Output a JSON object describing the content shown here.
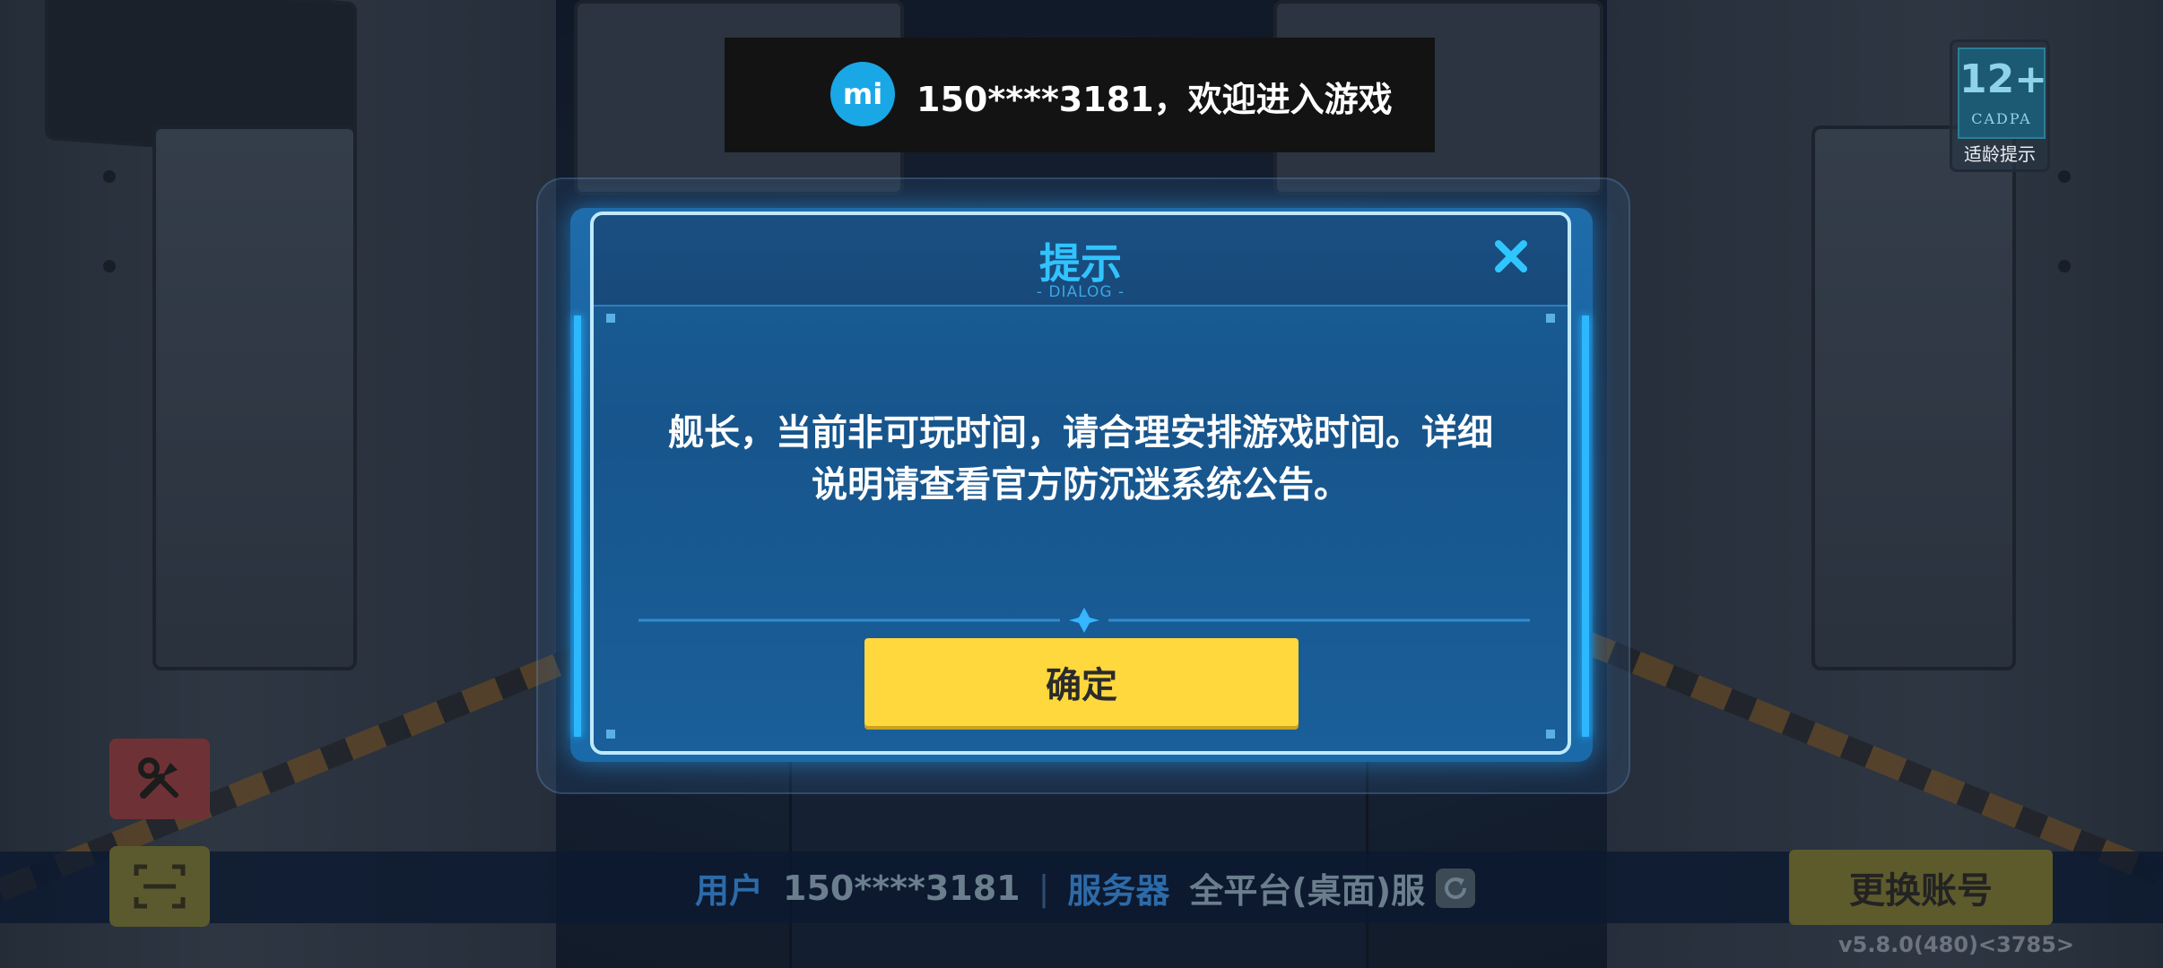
{
  "top_banner": {
    "logo": "mi",
    "welcome_text": "150****3181，欢迎进入游戏"
  },
  "age_rating": {
    "rating": "12+",
    "org": "CADPA",
    "label": "适龄提示"
  },
  "dialog": {
    "title": "提示",
    "subtitle": "- DIALOG -",
    "message_line1": "舰长，当前非可玩时间，请合理安排游戏时间。详细",
    "message_line2": "说明请查看官方防沉迷系统公告。",
    "confirm_label": "确定",
    "close_icon": "close-icon"
  },
  "bottom_bar": {
    "user_label": "用户",
    "user_value": "150****3181",
    "separator": "|",
    "server_label": "服务器",
    "server_value": "全平台(桌面)服",
    "switch_account_label": "更换账号",
    "version": "v5.8.0(480)<3785>"
  },
  "colors": {
    "confirm_button": "#ffd83d",
    "dialog_title": "#32c3ff",
    "dialog_bg": "#17558c",
    "logo_bg": "#1aa7e6"
  }
}
